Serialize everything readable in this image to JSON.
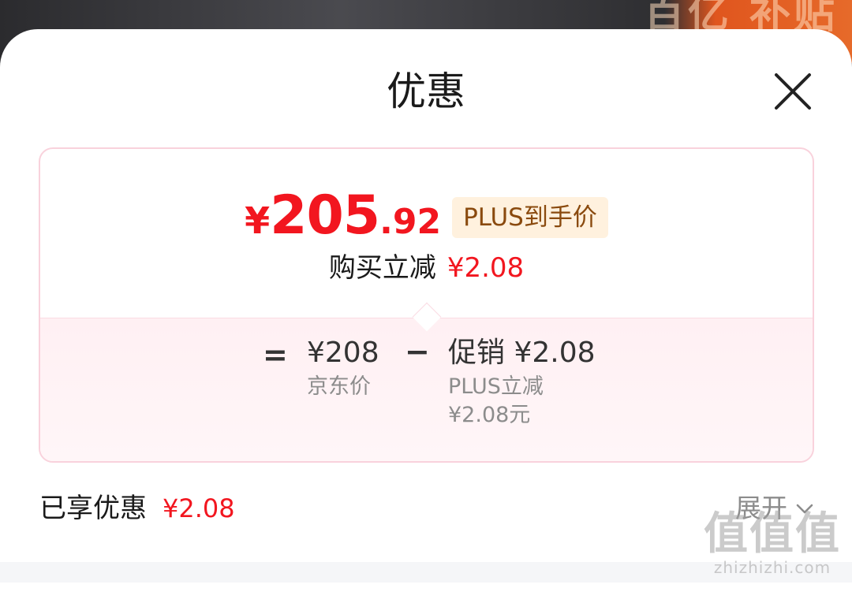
{
  "background": {
    "banner_text": "百亿\n补贴"
  },
  "sheet": {
    "title": "优惠",
    "close_icon": "close-icon"
  },
  "card": {
    "price": {
      "currency": "¥",
      "integer": "205",
      "decimal": ".92"
    },
    "plus_badge": "PLUS到手价",
    "instant_discount": {
      "label": "购买立减",
      "value": "¥2.08"
    },
    "calculation": {
      "equals": "=",
      "base": {
        "value": "¥208",
        "label": "京东价"
      },
      "minus": "−",
      "promo": {
        "value": "促销 ¥2.08",
        "detail_line1": "PLUS立减",
        "detail_line2": "¥2.08元"
      }
    }
  },
  "footer": {
    "enjoyed_label": "已享优惠",
    "enjoyed_value": "¥2.08",
    "expand_label": "展开",
    "expand_icon": "chevron-down-icon"
  },
  "watermark": {
    "main": "值值值",
    "site": "zhizhizhi.com"
  },
  "colors": {
    "accent_red": "#f2161f",
    "badge_bg": "#fff1de",
    "badge_text": "#8a4a0e",
    "card_border": "#f9d2dc"
  }
}
